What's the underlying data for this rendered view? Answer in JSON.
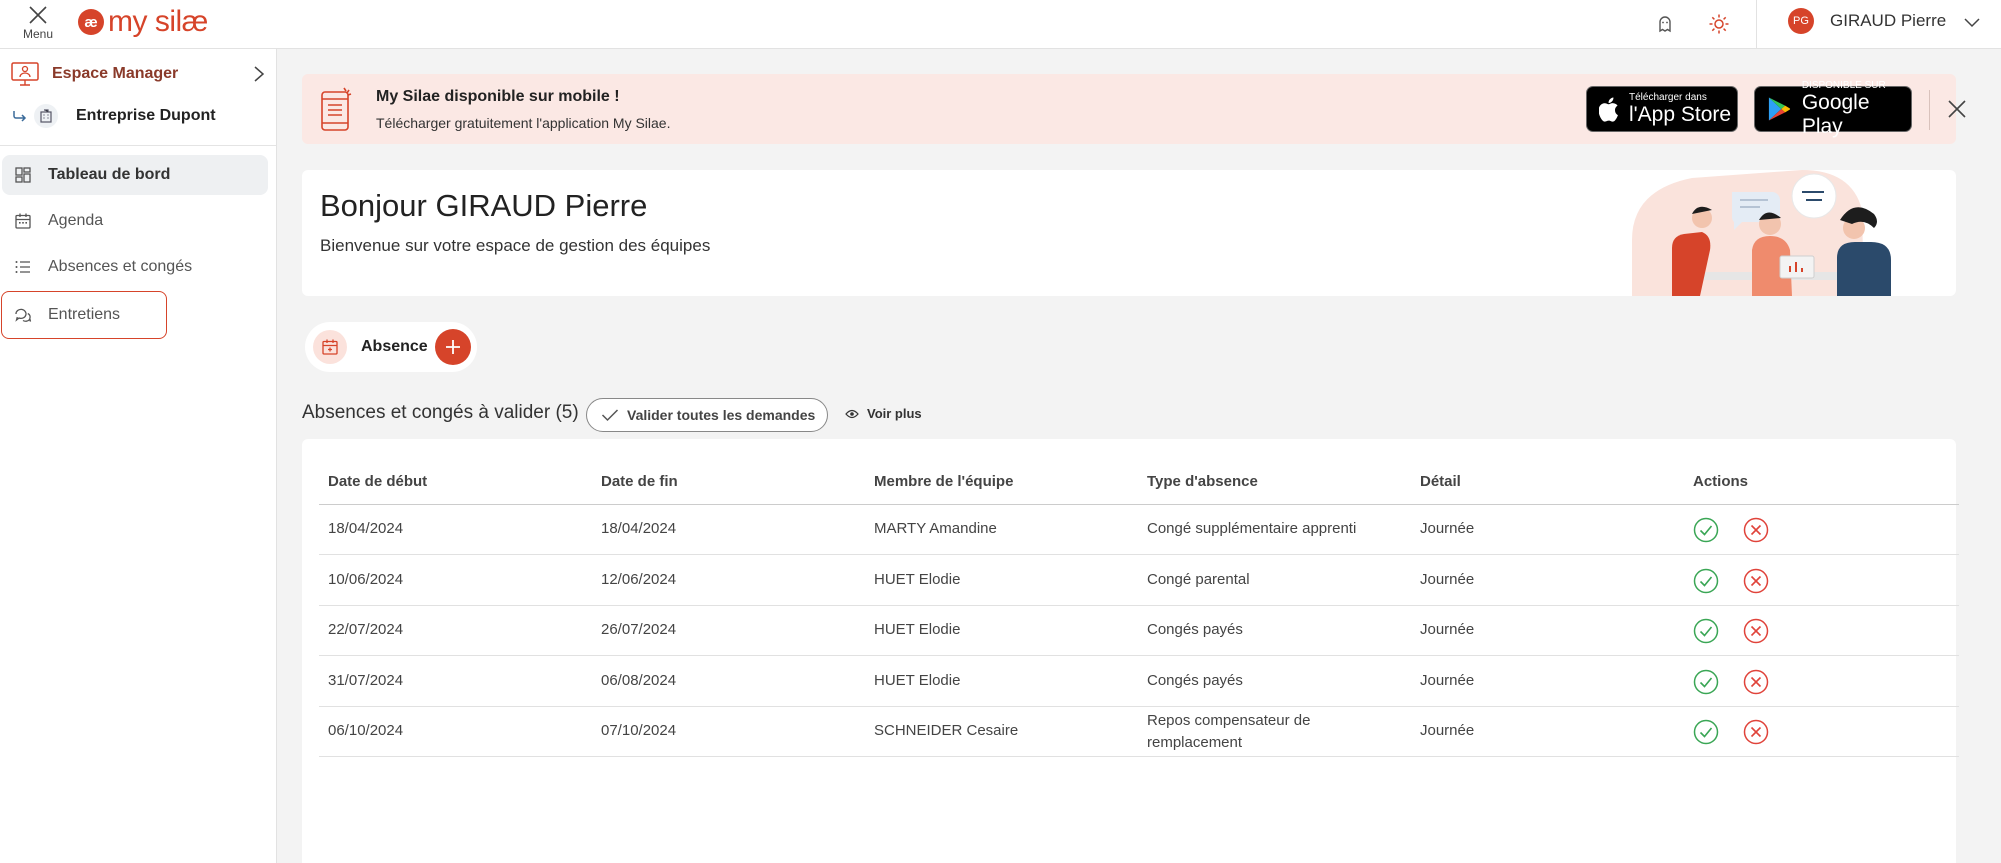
{
  "topbar": {
    "menu_label": "Menu",
    "logo_mark": "æ",
    "logo_text": "my silæ",
    "user_initials": "PG",
    "user_name": "GIRAUD Pierre",
    "icons": [
      "close-icon",
      "ghost-icon",
      "sun-icon",
      "chevron-down-icon"
    ]
  },
  "sidebar": {
    "space_label": "Espace Manager",
    "company_label": "Entreprise Dupont",
    "items": [
      {
        "label": "Tableau de bord",
        "icon": "dashboard-icon"
      },
      {
        "label": "Agenda",
        "icon": "calendar-icon"
      },
      {
        "label": "Absences et congés",
        "icon": "list-icon"
      },
      {
        "label": "Entretiens",
        "icon": "chat-icon"
      }
    ]
  },
  "banner": {
    "title": "My Silae disponible sur mobile !",
    "subtitle": "Télécharger gratuitement l'application My Silae.",
    "appstore_small": "Télécharger dans",
    "appstore_big": "l'App Store",
    "googleplay_small": "DISPONIBLE SUR",
    "googleplay_big": "Google Play"
  },
  "welcome": {
    "title": "Bonjour GIRAUD Pierre",
    "subtitle": "Bienvenue sur votre espace de gestion des équipes"
  },
  "quick_action": {
    "label": "Absence"
  },
  "validations": {
    "title": "Absences et congés à valider (5)",
    "validate_all_label": "Valider toutes les demandes",
    "see_more_label": "Voir plus",
    "columns": [
      "Date de début",
      "Date de fin",
      "Membre de l'équipe",
      "Type d'absence",
      "Détail",
      "Actions"
    ],
    "rows": [
      {
        "start": "18/04/2024",
        "end": "18/04/2024",
        "member": "MARTY Amandine",
        "type": "Congé supplémentaire apprenti",
        "type2": "",
        "detail": "Journée"
      },
      {
        "start": "10/06/2024",
        "end": "12/06/2024",
        "member": "HUET Elodie",
        "type": "Congé parental",
        "type2": "",
        "detail": "Journée"
      },
      {
        "start": "22/07/2024",
        "end": "26/07/2024",
        "member": "HUET Elodie",
        "type": "Congés payés",
        "type2": "",
        "detail": "Journée"
      },
      {
        "start": "31/07/2024",
        "end": "06/08/2024",
        "member": "HUET Elodie",
        "type": "Congés payés",
        "type2": "",
        "detail": "Journée"
      },
      {
        "start": "06/10/2024",
        "end": "07/10/2024",
        "member": "SCHNEIDER Cesaire",
        "type": "Repos compensateur de",
        "type2": "remplacement",
        "detail": "Journée"
      }
    ]
  },
  "colors": {
    "accent": "#d6442a",
    "success": "#3aa655",
    "danger": "#e0433a",
    "banner_bg": "#fbe8e4"
  }
}
